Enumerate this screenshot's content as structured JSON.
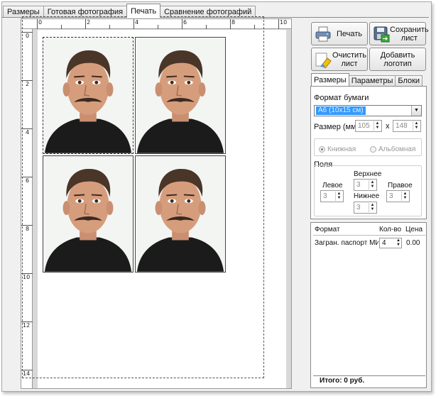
{
  "tabs": [
    {
      "label": "Размеры"
    },
    {
      "label": "Готовая фотография"
    },
    {
      "label": "Печать",
      "active": true
    },
    {
      "label": "Сравнение фотографий"
    }
  ],
  "ruler": {
    "top_numbers": [
      "0",
      "2",
      "4",
      "6",
      "8",
      "10"
    ],
    "left_numbers": [
      "0",
      "2",
      "4",
      "6",
      "8",
      "10",
      "12",
      "14"
    ]
  },
  "photos": {
    "count": 4,
    "alt": "passport-photo-man-with-mustache"
  },
  "buttons": {
    "print": "Печать",
    "save_sheet": "Сохранить лист",
    "clear_sheet": "Очистить лист",
    "add_logo": "Добавить логотип"
  },
  "settings_tabs": [
    {
      "label": "Размеры",
      "active": true
    },
    {
      "label": "Параметры"
    },
    {
      "label": "Блоки"
    }
  ],
  "paper": {
    "format_label": "Формат бумаги",
    "format_value": "A6 (10x15 см)",
    "size_label": "Размер (мм):",
    "width": "105",
    "x_sep": "x",
    "height": "148",
    "orientation_portrait": "Книжная",
    "orientation_landscape": "Альбомная"
  },
  "margins": {
    "label": "Поля",
    "top_label": "Верхнее",
    "top": "3",
    "left_label": "Левое",
    "left": "3",
    "right_label": "Правое",
    "right": "3",
    "bottom_label": "Нижнее",
    "bottom": "3"
  },
  "table": {
    "headers": [
      "Формат",
      "Кол-во",
      "Цена"
    ],
    "rows": [
      {
        "format": "Загран. паспорт МИД",
        "qty": "4",
        "price": "0.00"
      }
    ],
    "total": "Итого: 0 руб."
  },
  "colors": {
    "selection": "#3399ff",
    "window_bg": "#f0f0f0"
  }
}
